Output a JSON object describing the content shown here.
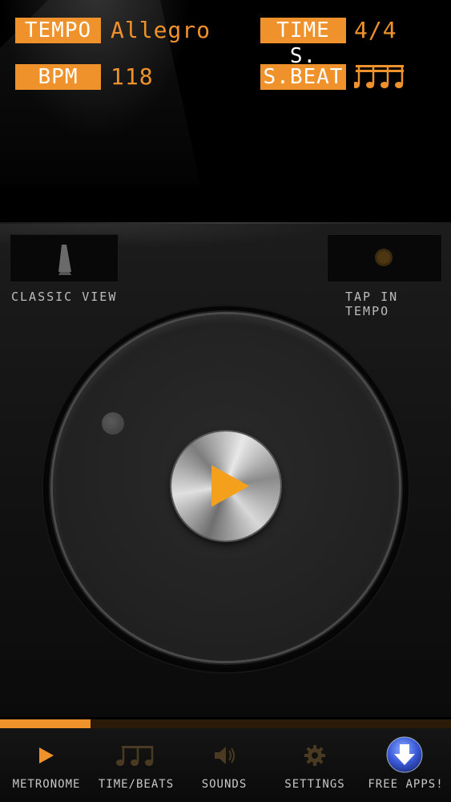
{
  "display": {
    "tempo_label": "TEMPO",
    "tempo_value": "Allegro",
    "bpm_label": "BPM",
    "bpm_value": "118",
    "time_sig_label": "TIME S.",
    "time_sig_value": "4/4",
    "sub_beat_label": "S.BEAT",
    "sub_beat_icon": "four-sixteenth-notes-icon"
  },
  "views": {
    "classic_view_label": "CLASSIC VIEW",
    "classic_view_icon": "metronome-icon",
    "tap_tempo_label": "TAP IN TEMPO",
    "tap_tempo_icon": "tap-light-icon"
  },
  "player": {
    "play_icon": "play-icon",
    "progress": 0.2
  },
  "tabs": [
    {
      "label": "METRONOME",
      "icon": "play-icon",
      "active": true
    },
    {
      "label": "TIME/BEATS",
      "icon": "beamed-notes-icon",
      "active": false
    },
    {
      "label": "SOUNDS",
      "icon": "speaker-icon",
      "active": false
    },
    {
      "label": "SETTINGS",
      "icon": "gear-icon",
      "active": false
    },
    {
      "label": "FREE APPS!",
      "icon": "download-icon",
      "active": false
    }
  ],
  "colors": {
    "accent": "#f0922b",
    "background": "#000000",
    "download_blue": "#3b5bdb"
  }
}
